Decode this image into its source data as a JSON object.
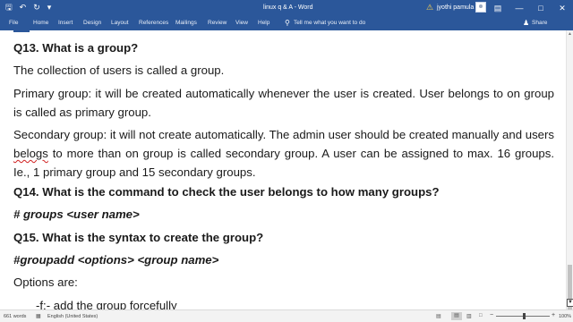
{
  "titlebar": {
    "doc_title": "linux q & A  -  Word",
    "user_name": "jyothi pamula",
    "qat": [
      "save-icon",
      "undo-icon",
      "redo-icon",
      "customize-icon"
    ],
    "window_buttons": [
      "ribbon-display-icon",
      "minimize-icon",
      "maximize-icon",
      "close-icon"
    ]
  },
  "ribbon": {
    "tabs": [
      "File",
      "Home",
      "Insert",
      "Design",
      "Layout",
      "References",
      "Mailings",
      "Review",
      "View",
      "Help"
    ],
    "tell_me": "Tell me what you want to do",
    "share": "Share"
  },
  "document": {
    "q13": "Q13. What is a group?",
    "p1": "The collection of users is called a group.",
    "p2": "Primary group: it will be created automatically whenever the user is created. User belongs to on group is called as primary group.",
    "p3_a": "Secondary group: it will not create automatically. The admin user should be created manually and users ",
    "p3_misspelled": "belogs",
    "p3_b": " to more than on group is called secondary group. A user can be assigned to max. 16 groups. Ie., 1 primary group and 15 secondary groups.",
    "q14": "Q14. What is the command to check the user belongs to how many groups?",
    "cmd1": "# groups <user name>",
    "q15": "Q15. What is the syntax to create the group?",
    "cmd2": "#groupadd <options> <group name>",
    "options_label": "Options are:",
    "option_f_flag": "-f:-",
    "option_f_text": " add the group forcefully"
  },
  "statusbar": {
    "word_count": "661 words",
    "language": "English (United States)",
    "zoom": "100%",
    "zoom_level": 1.0
  },
  "colors": {
    "title_bar": "#2b579a",
    "status_bar": "#f3f3f3",
    "text": "#1a1a1a"
  }
}
